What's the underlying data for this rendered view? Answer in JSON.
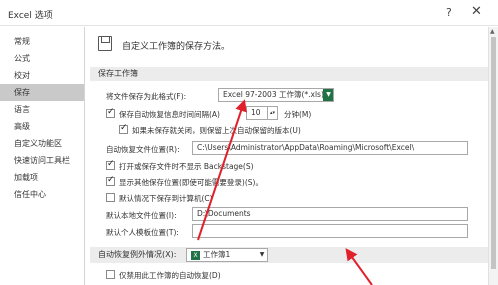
{
  "window": {
    "title": "Excel 选项",
    "help_icon": "?",
    "close_icon": "✕"
  },
  "sidebar": {
    "items": [
      {
        "label": "常规"
      },
      {
        "label": "公式"
      },
      {
        "label": "校对"
      },
      {
        "label": "保存"
      },
      {
        "label": "语言"
      },
      {
        "label": "高级"
      },
      {
        "label": "自定义功能区"
      },
      {
        "label": "快速访问工具栏"
      },
      {
        "label": "加载项"
      },
      {
        "label": "信任中心"
      }
    ],
    "active_index": 3
  },
  "header": {
    "icon": "save-icon",
    "text": "自定义工作簿的保存方法。"
  },
  "save_section": {
    "title": "保存工作簿",
    "format_label": "将文件保存为此格式(F):",
    "format_value": "Excel 97-2003 工作簿(*.xls)",
    "autorecover_label": "保存自动恢复信息时间间隔(A)",
    "autorecover_minutes": "10",
    "minutes_label": "分钟(M)",
    "keep_last_label": "如果未保存就关闭，则保留上次自动保留的版本(U)",
    "autorecover_location_label": "自动恢复文件位置(R):",
    "autorecover_location_value": "C:\\Users\\Administrator\\AppData\\Roaming\\Microsoft\\Excel\\",
    "no_backstage_label": "打开或保存文件时不显示 Backstage(S)",
    "show_more_places_label": "显示其他保存位置(即使可能需要登录)(S)。",
    "save_to_computer_label": "默认情况下保存到计算机(C)",
    "default_local_label": "默认本地文件位置(I):",
    "default_local_value": "D:\\Documents",
    "personal_templates_label": "默认个人模板位置(T):",
    "personal_templates_value": ""
  },
  "autorecover_exceptions": {
    "title": "自动恢复例外情况(X):",
    "workbook_value": "工作簿1",
    "disable_label": "仅禁用此工作簿的自动恢复(D)"
  },
  "colors": {
    "arrow": "#e0202a",
    "excel_green": "#217346"
  }
}
